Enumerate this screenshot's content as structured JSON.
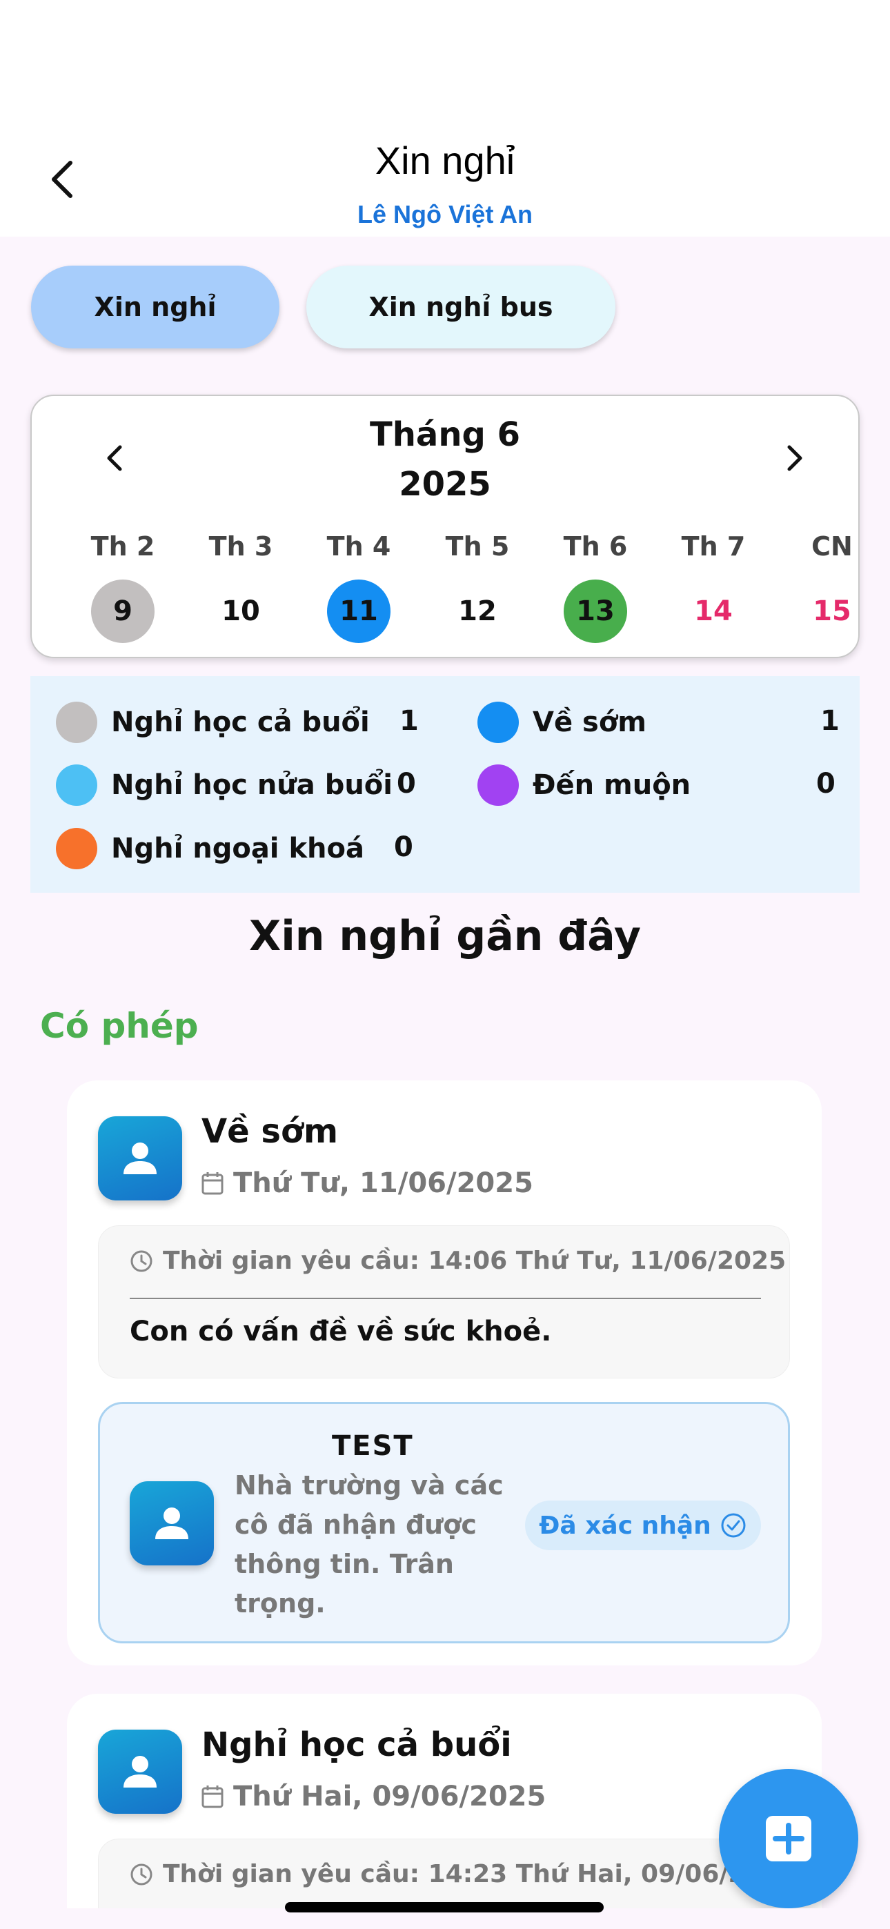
{
  "header": {
    "title": "Xin nghỉ",
    "student_name": "Lê Ngô Việt  An",
    "back_icon": "chevron-left-icon"
  },
  "tabs": [
    {
      "label": "Xin nghỉ",
      "active": true,
      "color": "#a7cdfb"
    },
    {
      "label": "Xin nghỉ bus",
      "active": false,
      "color": "#e3f7fc"
    }
  ],
  "calendar": {
    "month_label": "Tháng 6",
    "year_label": "2025",
    "weekdays": [
      "Th 2",
      "Th 3",
      "Th 4",
      "Th 5",
      "Th 6",
      "Th 7",
      "CN"
    ],
    "days": [
      {
        "label": "9",
        "highlight": "#c2bfbf",
        "text_color": "#111111"
      },
      {
        "label": "10",
        "highlight": "",
        "text_color": "#111111"
      },
      {
        "label": "11",
        "highlight": "#148ef2",
        "text_color": "#111111"
      },
      {
        "label": "12",
        "highlight": "",
        "text_color": "#111111"
      },
      {
        "label": "13",
        "highlight": "#48ae4c",
        "text_color": "#111111"
      },
      {
        "label": "14",
        "highlight": "",
        "text_color": "#e52a6a"
      },
      {
        "label": "15",
        "highlight": "",
        "text_color": "#e52a6a"
      }
    ]
  },
  "stats": [
    {
      "label": "Nghỉ học cả buổi",
      "value": "1",
      "color": "#c2bfbf"
    },
    {
      "label": "Về sớm",
      "value": "1",
      "color": "#148ef2"
    },
    {
      "label": "Nghỉ học nửa buổi",
      "value": "0",
      "color": "#4dc0f4"
    },
    {
      "label": "Đến muộn",
      "value": "0",
      "color": "#a142f2"
    },
    {
      "label": "Nghỉ ngoại khoá",
      "value": "0",
      "color": "#f7712b"
    }
  ],
  "recent": {
    "title": "Xin nghỉ gần đây",
    "group_title": "Có phép",
    "group_color": "#4caf50",
    "requests": [
      {
        "type": "Về sớm",
        "date": "Thứ Tư, 11/06/2025",
        "request_time": "Thời gian yêu cầu: 14:06 Thứ Tư, 11/06/2025",
        "reason": "Con có vấn đề về sức khoẻ.",
        "reply": {
          "name": "TEST",
          "message": "Nhà trường và các cô đã nhận được thông tin. Trân trọng.",
          "status": "Đã xác nhận"
        }
      },
      {
        "type": "Nghỉ học cả buổi",
        "date": "Thứ Hai, 09/06/2025",
        "request_time": "Thời gian yêu cầu: 14:23 Thứ Hai, 09/06/2025"
      }
    ]
  },
  "fab": {
    "icon": "add-square-icon",
    "color": "#2d96ef"
  }
}
